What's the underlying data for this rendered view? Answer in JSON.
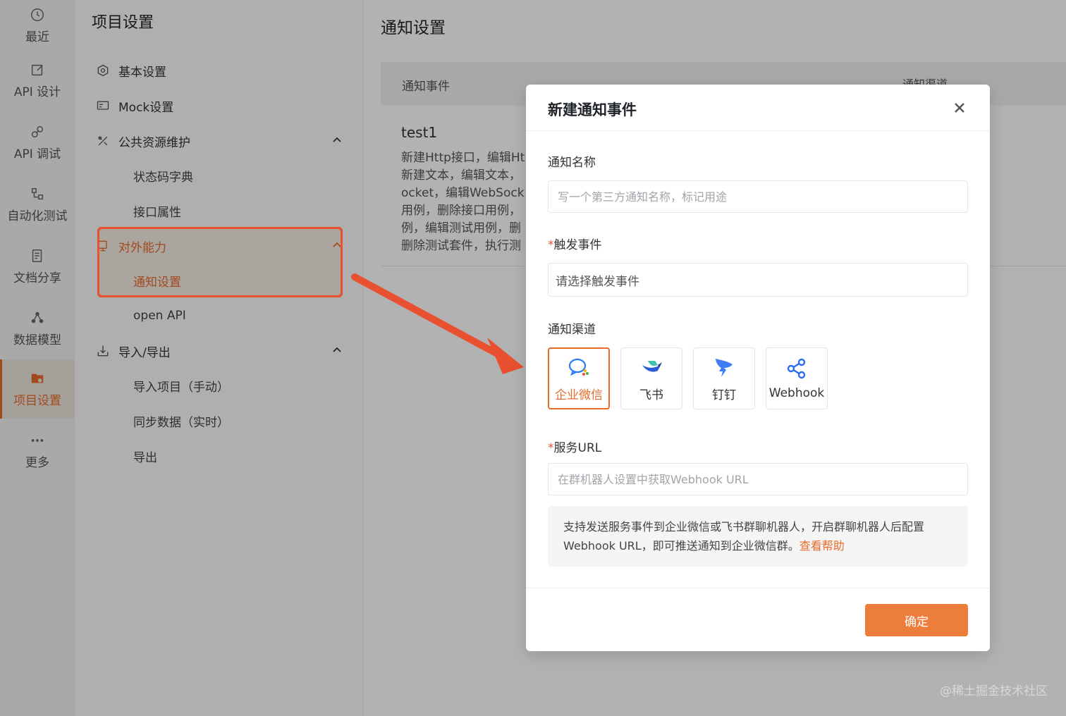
{
  "rail": {
    "items": [
      {
        "label": "最近",
        "icon": "clock-icon"
      },
      {
        "label": "API 设计",
        "icon": "edit-icon"
      },
      {
        "label": "API 调试",
        "icon": "link-icon"
      },
      {
        "label": "自动化测试",
        "icon": "flow-icon"
      },
      {
        "label": "文档分享",
        "icon": "doc-icon"
      },
      {
        "label": "数据模型",
        "icon": "model-icon"
      },
      {
        "label": "项目设置",
        "icon": "folder-gear-icon"
      },
      {
        "label": "更多",
        "icon": "more-icon"
      }
    ]
  },
  "nav": {
    "title": "项目设置",
    "items": {
      "basic": "基本设置",
      "mock": "Mock设置",
      "public": "公共资源维护",
      "status_dict": "状态码字典",
      "api_attr": "接口属性",
      "external": "对外能力",
      "notify": "通知设置",
      "open_api": "open API",
      "import_export": "导入/导出",
      "import_manual": "导入项目（手动）",
      "sync": "同步数据（实时）",
      "export": "导出"
    }
  },
  "main": {
    "title": "通知设置",
    "columns": {
      "event": "通知事件",
      "channel": "通知渠道"
    },
    "row": {
      "name": "test1",
      "desc_lines": [
        "新建Http接口，编辑Ht",
        "新建文本，编辑文本，",
        "ocket，编辑WebSock",
        "用例，删除接口用例，",
        "例，编辑测试用例，删",
        "删除测试套件，执行测"
      ]
    }
  },
  "modal": {
    "title": "新建通知事件",
    "name_label": "通知名称",
    "name_placeholder": "写一个第三方通知名称，标记用途",
    "trigger_required": "*",
    "trigger_label": "触发事件",
    "trigger_placeholder": "请选择触发事件",
    "channel_label": "通知渠道",
    "channels": [
      {
        "label": "企业微信",
        "icon": "wecom-icon",
        "selected": true
      },
      {
        "label": "飞书",
        "icon": "feishu-icon",
        "selected": false
      },
      {
        "label": "钉钉",
        "icon": "dingtalk-icon",
        "selected": false
      },
      {
        "label": "Webhook",
        "icon": "webhook-icon",
        "selected": false
      }
    ],
    "url_required": "*",
    "url_label": "服务URL",
    "url_placeholder": "在群机器人设置中获取Webhook URL",
    "tip_text": "支持发送服务事件到企业微信或飞书群聊机器人，开启群聊机器人后配置Webhook URL，即可推送通知到企业微信群。",
    "tip_link": "查看帮助",
    "ok_label": "确定"
  },
  "colors": {
    "accent": "#e86b28",
    "highlight_border": "#e8502f"
  },
  "watermark": "@稀土掘金技术社区"
}
